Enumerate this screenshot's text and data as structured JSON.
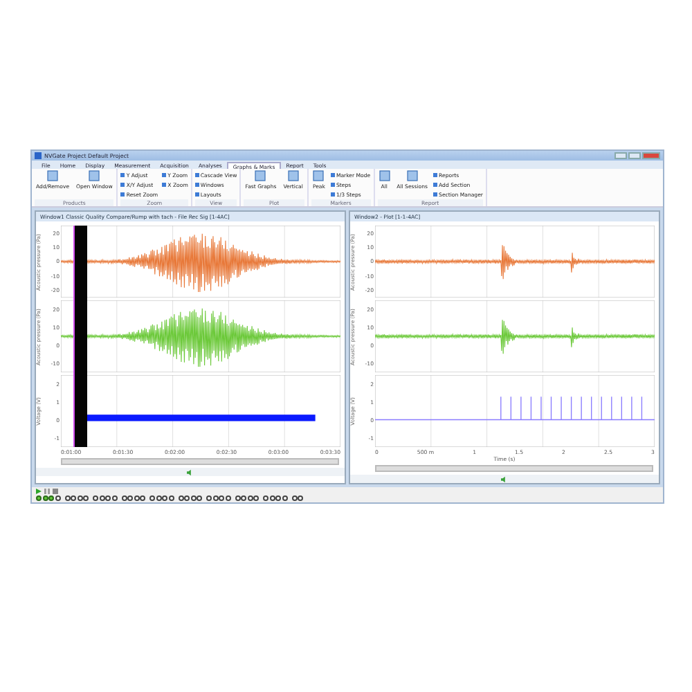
{
  "window": {
    "title": "NVGate Project Default Project"
  },
  "menu_tabs": [
    {
      "label": "File",
      "selected": false
    },
    {
      "label": "Home",
      "selected": false
    },
    {
      "label": "Display",
      "selected": false
    },
    {
      "label": "Measurement",
      "selected": false
    },
    {
      "label": "Acquisition",
      "selected": false
    },
    {
      "label": "Analyses",
      "selected": false
    },
    {
      "label": "Graphs & Marks",
      "selected": true
    },
    {
      "label": "Report",
      "selected": false
    },
    {
      "label": "Tools",
      "selected": false
    }
  ],
  "ribbon_groups": [
    {
      "label": "Products",
      "buttons": [
        {
          "kind": "large",
          "label": "Add/Remove"
        },
        {
          "kind": "large",
          "label": "Open Window"
        }
      ]
    },
    {
      "label": "Zoom",
      "buttons": [
        {
          "kind": "small",
          "label": "Y Adjust"
        },
        {
          "kind": "small",
          "label": "X/Y Adjust"
        },
        {
          "kind": "small",
          "label": "Reset Zoom"
        },
        {
          "kind": "small",
          "label": "Y Zoom"
        },
        {
          "kind": "small",
          "label": "X Zoom"
        }
      ]
    },
    {
      "label": "View",
      "buttons": [
        {
          "kind": "small",
          "label": "Cascade View"
        },
        {
          "kind": "small",
          "label": "Windows"
        },
        {
          "kind": "small",
          "label": "Layouts"
        }
      ]
    },
    {
      "label": "Plot",
      "buttons": [
        {
          "kind": "large",
          "label": "Fast Graphs"
        },
        {
          "kind": "large",
          "label": "Vertical"
        }
      ]
    },
    {
      "label": "Markers",
      "buttons": [
        {
          "kind": "large",
          "label": "Peak"
        },
        {
          "kind": "small",
          "label": "Marker Mode"
        },
        {
          "kind": "small",
          "label": "Steps"
        },
        {
          "kind": "small",
          "label": "1/3 Steps"
        }
      ]
    },
    {
      "label": "Report",
      "buttons": [
        {
          "kind": "large",
          "label": "All"
        },
        {
          "kind": "large",
          "label": "All Sessions"
        },
        {
          "kind": "small",
          "label": "Reports"
        },
        {
          "kind": "small",
          "label": "Add Section"
        },
        {
          "kind": "small",
          "label": "Section Manager"
        }
      ]
    }
  ],
  "panels": [
    {
      "title": "Window1 Classic Quality Compare/Rump with tach - File Rec Sig [1-4AC]",
      "cursor_band": true,
      "xticks": [
        "0:01:00",
        "0:01:30",
        "0:02:00",
        "0:02:30",
        "0:03:00",
        "0:03:30"
      ],
      "traces": [
        {
          "kind": "burst",
          "color": "#e8793a",
          "ylabel": "Acoustic pressure (Pa)",
          "yticks": [
            "20",
            "10",
            "0",
            "-10",
            "-20"
          ]
        },
        {
          "kind": "burst",
          "color": "#6cc93a",
          "ylabel": "Acoustic pressure (Pa)",
          "yticks": [
            "20",
            "10",
            "0",
            "-10"
          ]
        },
        {
          "kind": "bar",
          "color": "#0a1aff",
          "ylabel": "Voltage (V)",
          "yticks": [
            "2",
            "1",
            "0",
            "-1"
          ]
        }
      ]
    },
    {
      "title": "Window2 - Plot [1-1-4AC]",
      "cursor_band": false,
      "xticks": [
        "0",
        "500 m",
        "1",
        "1.5",
        "2",
        "2.5",
        "3"
      ],
      "xlabel": "Time (s)",
      "traces": [
        {
          "kind": "transient",
          "color": "#e8793a",
          "ylabel": "Acoustic pressure (Pa)",
          "yticks": [
            "20",
            "10",
            "0",
            "-10",
            "-20"
          ]
        },
        {
          "kind": "transient",
          "color": "#6cc93a",
          "ylabel": "Acoustic pressure (Pa)",
          "yticks": [
            "20",
            "10",
            "0",
            "-10"
          ]
        },
        {
          "kind": "pulses",
          "color": "#8a7cff",
          "ylabel": "Voltage (V)",
          "yticks": [
            "2",
            "1",
            "0",
            "-1"
          ]
        }
      ]
    }
  ],
  "input_groups": [
    {
      "inputs": [
        {
          "on": true
        },
        {
          "on": true
        },
        {
          "on": true
        },
        {
          "on": false
        }
      ]
    },
    {
      "inputs": [
        {
          "on": false
        },
        {
          "on": false
        },
        {
          "on": false
        },
        {
          "on": false
        }
      ]
    },
    {
      "inputs": [
        {
          "on": false
        },
        {
          "on": false
        },
        {
          "on": false
        },
        {
          "on": false
        }
      ]
    },
    {
      "inputs": [
        {
          "on": false
        },
        {
          "on": false
        },
        {
          "on": false
        },
        {
          "on": false
        }
      ]
    },
    {
      "inputs": [
        {
          "on": false
        },
        {
          "on": false
        },
        {
          "on": false
        },
        {
          "on": false
        }
      ]
    },
    {
      "inputs": [
        {
          "on": false
        },
        {
          "on": false
        },
        {
          "on": false
        },
        {
          "on": false
        }
      ]
    },
    {
      "inputs": [
        {
          "on": false
        },
        {
          "on": false
        },
        {
          "on": false
        },
        {
          "on": false
        }
      ]
    },
    {
      "inputs": [
        {
          "on": false
        },
        {
          "on": false
        },
        {
          "on": false
        },
        {
          "on": false
        }
      ]
    },
    {
      "inputs": [
        {
          "on": false
        },
        {
          "on": false
        },
        {
          "on": false
        },
        {
          "on": false
        }
      ]
    },
    {
      "inputs": [
        {
          "on": false
        },
        {
          "on": false
        }
      ]
    }
  ]
}
